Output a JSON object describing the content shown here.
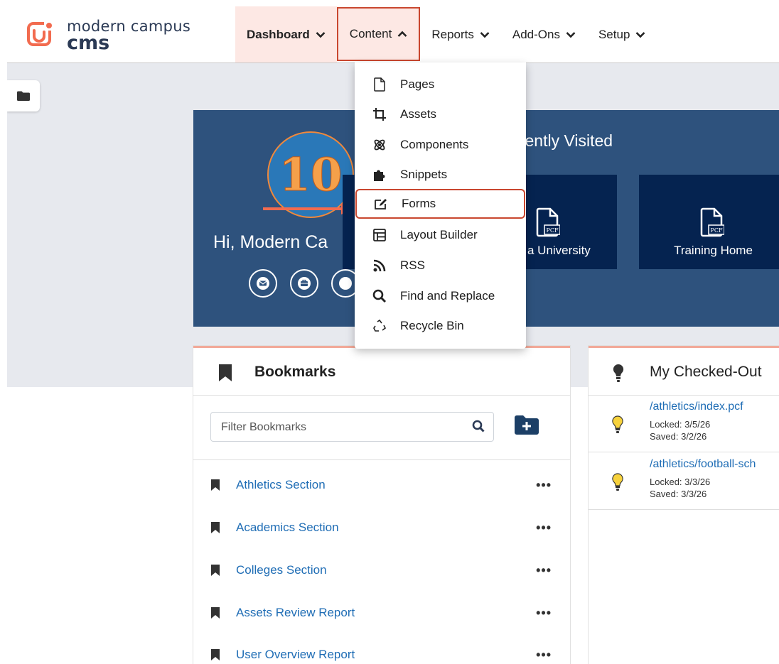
{
  "brand": {
    "line1": "modern campus",
    "line2": "cms",
    "color": "#f26b4f"
  },
  "nav": {
    "dashboard": "Dashboard",
    "content": "Content",
    "reports": "Reports",
    "addons": "Add-Ons",
    "setup": "Setup"
  },
  "content_menu": {
    "pages": "Pages",
    "assets": "Assets",
    "components": "Components",
    "snippets": "Snippets",
    "forms": "Forms",
    "layout_builder": "Layout Builder",
    "rss": "RSS",
    "find_replace": "Find and Replace",
    "recycle_bin": "Recycle Bin"
  },
  "hero": {
    "recently_visited_title": "cently Visited",
    "greeting": "Hi, Modern Ca",
    "step_number": "10",
    "tile1_label": "a University",
    "tile2_label": "Training Home",
    "file_badge": "PCF"
  },
  "bookmarks": {
    "title": "Bookmarks",
    "filter_placeholder": "Filter Bookmarks",
    "items": [
      {
        "label": "Athletics Section",
        "more": "•••"
      },
      {
        "label": "Academics Section",
        "more": "•••"
      },
      {
        "label": "Colleges Section",
        "more": "•••"
      },
      {
        "label": "Assets Review Report",
        "more": "•••"
      },
      {
        "label": "User Overview Report",
        "more": "•••"
      }
    ]
  },
  "checked_out": {
    "title": "My Checked-Out",
    "items": [
      {
        "path": "/athletics/index.pcf",
        "locked": "Locked: 3/5/26",
        "saved": "Saved: 3/2/26"
      },
      {
        "path": "/athletics/football-sch",
        "locked": "Locked: 3/3/26",
        "saved": "Saved: 3/3/26"
      }
    ]
  },
  "colors": {
    "accent": "#c9472f",
    "hero_bg": "#2e527d",
    "tile_bg": "#052350",
    "link": "#1f6db5"
  }
}
